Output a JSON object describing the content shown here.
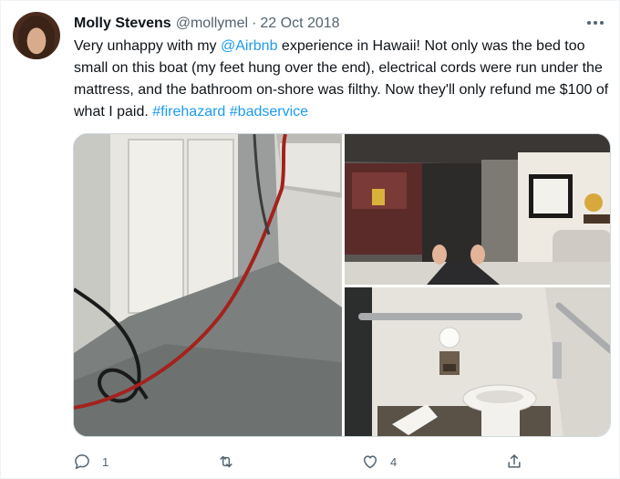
{
  "tweet": {
    "author_name": "Molly Stevens",
    "author_handle": "@mollymel",
    "separator": "·",
    "date": "22 Oct 2018",
    "text_parts": {
      "p1": "Very unhappy with my ",
      "mention": "@Airbnb",
      "p2": " experience in Hawaii! Not only was the bed too small on this boat (my feet hung over the end), electrical cords were run under the mattress, and the bathroom on-shore was filthy. Now they'll only refund me $100 of what I paid. ",
      "hashtag1": "#firehazard",
      "space": " ",
      "hashtag2": "#badservice"
    },
    "media_count": 3
  },
  "actions": {
    "reply_count": "1",
    "retweet_count": "",
    "like_count": "4"
  },
  "colors": {
    "link": "#1d9bf0",
    "muted": "#536471",
    "text": "#0f1419"
  },
  "icons": [
    "more-icon",
    "reply-icon",
    "retweet-icon",
    "like-icon",
    "share-icon"
  ]
}
